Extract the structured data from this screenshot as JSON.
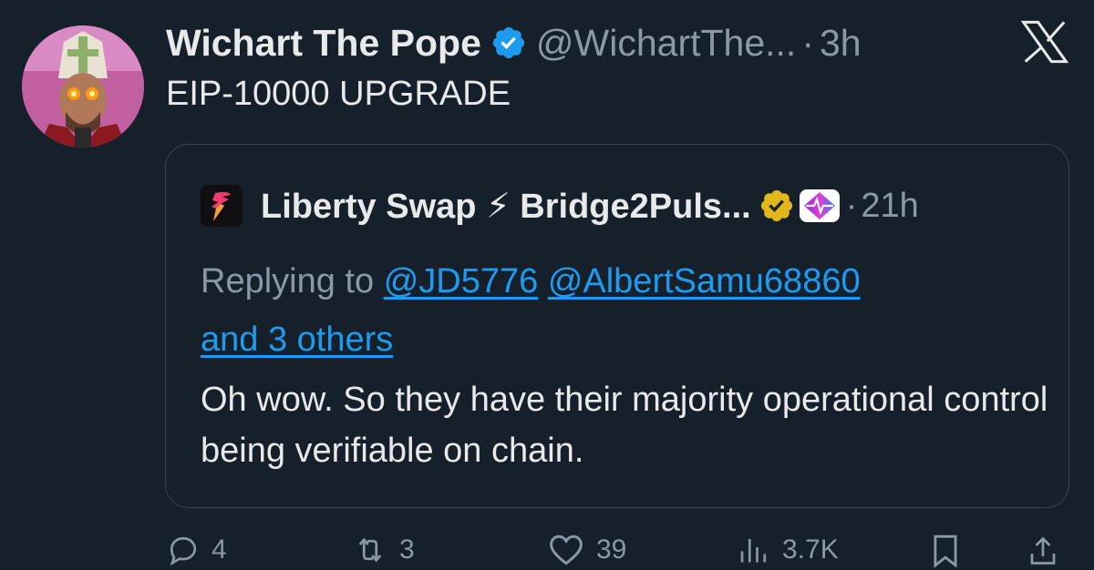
{
  "author": {
    "name": "Wichart The Pope",
    "handle": "@WichartThe...",
    "separator": "·",
    "time": "3h",
    "avatar_icon": "avatar-pope",
    "verified_color": "#1d9bf0"
  },
  "brand": {
    "icon": "x-logo"
  },
  "post": {
    "text": "EIP-10000 UPGRADE"
  },
  "quoted": {
    "name": "Liberty Swap ⚡ Bridge2Puls...",
    "separator": "·",
    "time": "21h",
    "badge_color": "#e2b719",
    "replying_prefix": "Replying to",
    "mentions": [
      "@JD5776",
      "@AlbertSamu68860"
    ],
    "others": "and 3 others",
    "body": "Oh wow. So they have their majority operational control being verifiable on chain."
  },
  "actions": {
    "replies": "4",
    "reposts": "3",
    "likes": "39",
    "views": "3.7K"
  },
  "colors": {
    "background": "#15202b",
    "text": "#e7e9ea",
    "muted": "#8b98a5",
    "link": "#1d9bf0",
    "border": "#38444d"
  }
}
